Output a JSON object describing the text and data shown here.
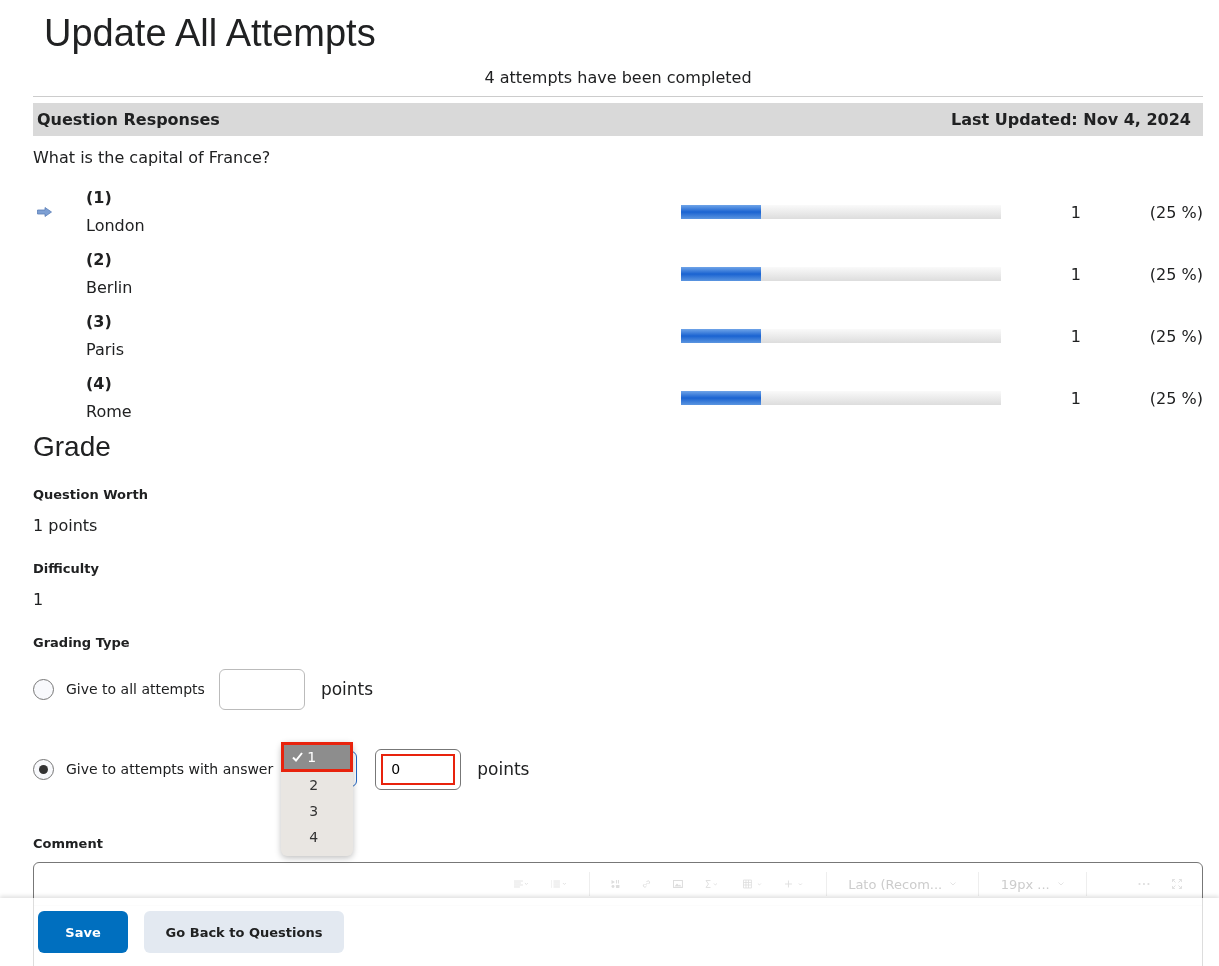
{
  "title": "Update All Attempts",
  "summary": "4 attempts have been completed",
  "responses": {
    "heading": "Question Responses",
    "updated": "Last Updated: Nov 4, 2024",
    "question": "What is the capital of France?",
    "answers": [
      {
        "number": "(1)",
        "text": "London",
        "correct": true,
        "level": 0.25,
        "count": "1",
        "percent": "(25 %)"
      },
      {
        "number": "(2)",
        "text": "Berlin",
        "correct": false,
        "level": 0.25,
        "count": "1",
        "percent": "(25 %)"
      },
      {
        "number": "(3)",
        "text": "Paris",
        "correct": false,
        "level": 0.25,
        "count": "1",
        "percent": "(25 %)"
      },
      {
        "number": "(4)",
        "text": "Rome",
        "correct": false,
        "level": 0.25,
        "count": "1",
        "percent": "(25 %)"
      }
    ]
  },
  "grade": {
    "heading": "Grade",
    "fields": [
      {
        "label": "Question Worth",
        "value": "1 points"
      },
      {
        "label": "Difficulty",
        "value": "1"
      }
    ],
    "grading_type": {
      "label": "Grading Type",
      "options": [
        {
          "kind": "plain",
          "label": "Give to all attempts",
          "selected": false,
          "unit": "points"
        },
        {
          "kind": "select",
          "label": "Give to attempts with answer",
          "selected": true,
          "value": "0",
          "unit": "points",
          "highlighted": true,
          "dropdown": [
            {
              "label": "1",
              "selected": true
            },
            {
              "label": "2",
              "selected": false
            },
            {
              "label": "3",
              "selected": false
            },
            {
              "label": "4",
              "selected": false
            }
          ]
        }
      ]
    }
  },
  "comment": {
    "label": "Comment",
    "font": "Lato (Recom...",
    "size": "19px ..."
  },
  "buttons": [
    {
      "label": "Save",
      "kind": "primary"
    },
    {
      "label": "Go Back to Questions",
      "kind": "secondary"
    }
  ]
}
